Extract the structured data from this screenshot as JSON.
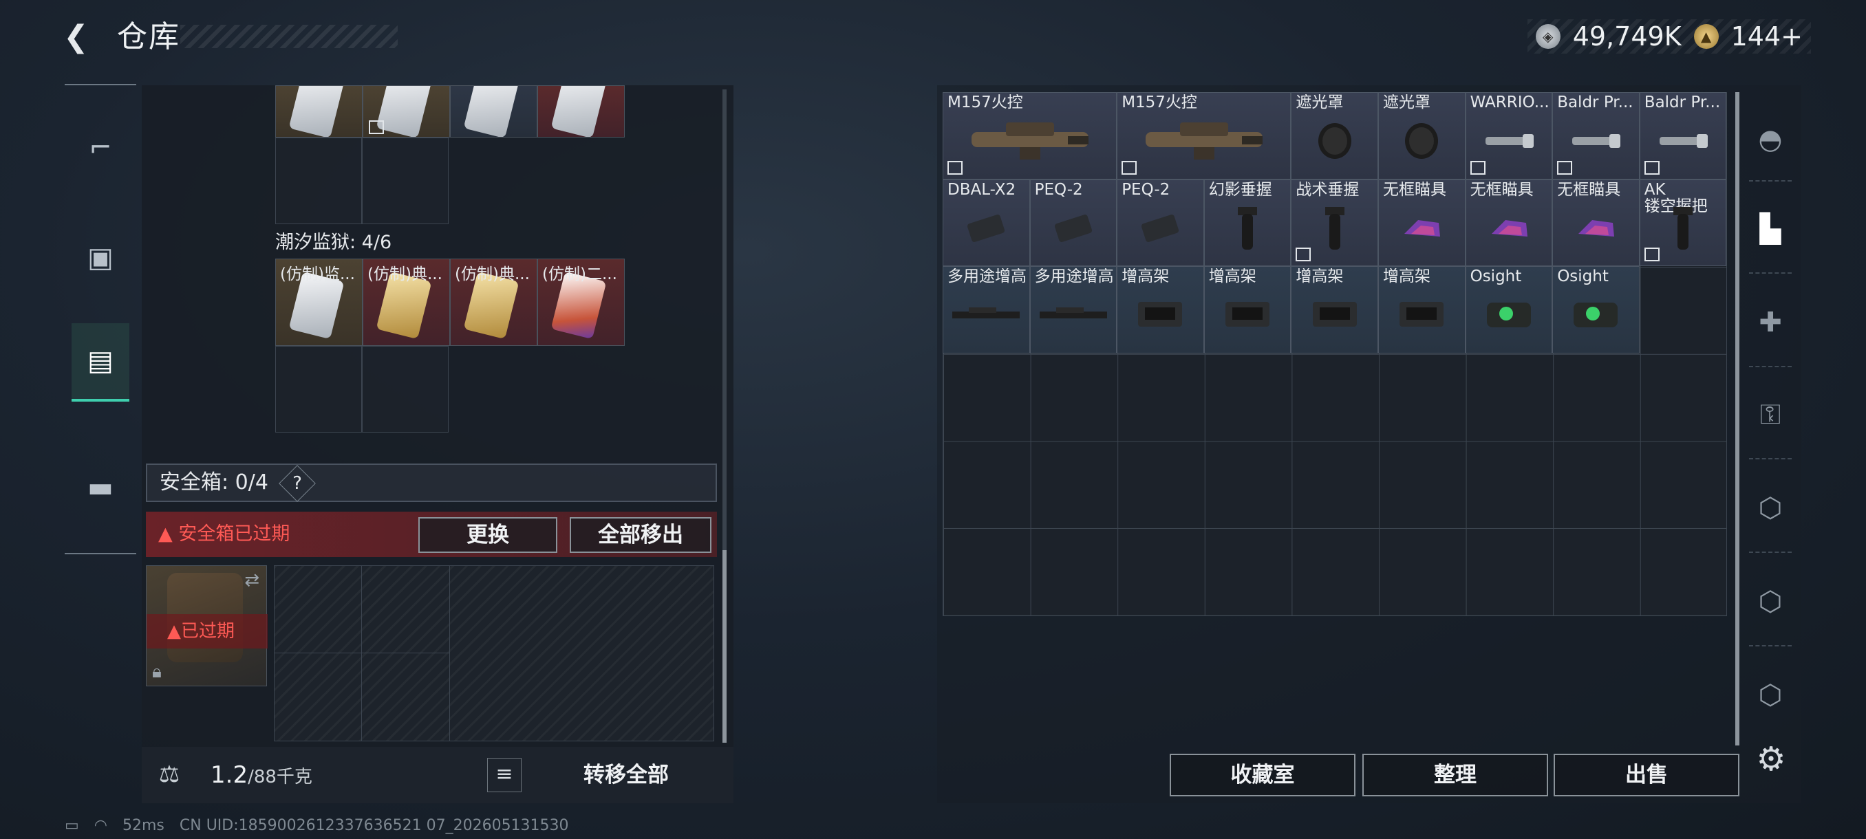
{
  "header": {
    "title": "仓库",
    "back_icon": "back-arrow-icon"
  },
  "currency": {
    "silver": "49,749K",
    "gold": "144+"
  },
  "left_nav": [
    "gun-icon",
    "backpack-icon",
    "chest-rig-icon",
    "briefcase-icon"
  ],
  "left_panel": {
    "tide_prison_label": "潮汐监狱: 4/6",
    "top_cards": [
      {
        "bg": "tan"
      },
      {
        "bg": "tan"
      },
      {
        "bg": "blu"
      },
      {
        "bg": "red"
      }
    ],
    "tide_cards": [
      {
        "label": "(仿制)监...",
        "bg": "tan",
        "img": "white"
      },
      {
        "label": "(仿制)典...",
        "bg": "red",
        "img": "gold"
      },
      {
        "label": "(仿制)典...",
        "bg": "red",
        "img": "gold"
      },
      {
        "label": "(仿制)二...",
        "bg": "red",
        "img": "multi"
      }
    ],
    "safe_label": "安全箱: 0/4",
    "help": "?",
    "expired_warning": "安全箱已过期",
    "replace_button": "更换",
    "move_all_out_button": "全部移出",
    "safebox_status": "已过期",
    "weight_value": "1.2",
    "weight_max": "/88千克",
    "transfer_all_button": "转移全部"
  },
  "status_bar": {
    "ping": "52ms",
    "uid": "CN UID:1859002612337636521 07_202605131530"
  },
  "right_grid": {
    "rows": [
      [
        {
          "label": "M157火控",
          "span": 2,
          "pic": "scope",
          "nomod": true,
          "bg": 1
        },
        {
          "label": "M157火控",
          "span": 2,
          "pic": "scope",
          "nomod": true,
          "bg": 1
        },
        {
          "label": "遮光罩",
          "span": 1,
          "pic": "hood",
          "nomod": false,
          "bg": 1
        },
        {
          "label": "遮光罩",
          "span": 1,
          "pic": "hood",
          "nomod": false,
          "bg": 1
        },
        {
          "label": "WARRIO...",
          "span": 1,
          "pic": "light",
          "nomod": true,
          "bg": 1
        },
        {
          "label": "Baldr Pr...",
          "span": 1,
          "pic": "light",
          "nomod": true,
          "bg": 1
        },
        {
          "label": "Baldr Pr...",
          "span": 1,
          "pic": "light",
          "nomod": true,
          "bg": 1
        }
      ],
      [
        {
          "label": "DBAL-X2",
          "span": 1,
          "pic": "laser",
          "nomod": false,
          "bg": 1
        },
        {
          "label": "PEQ-2",
          "span": 1,
          "pic": "laser",
          "nomod": false,
          "bg": 1
        },
        {
          "label": "PEQ-2",
          "span": 1,
          "pic": "laser",
          "nomod": false,
          "bg": 1
        },
        {
          "label": "幻影垂握",
          "span": 1,
          "pic": "grip",
          "nomod": false,
          "bg": 1
        },
        {
          "label": "战术垂握",
          "span": 1,
          "pic": "grip",
          "nomod": true,
          "bg": 1
        },
        {
          "label": "无框瞄具",
          "span": 1,
          "pic": "sight",
          "nomod": false,
          "bg": 1
        },
        {
          "label": "无框瞄具",
          "span": 1,
          "pic": "sight",
          "nomod": false,
          "bg": 1
        },
        {
          "label": "无框瞄具",
          "span": 1,
          "pic": "sight",
          "nomod": false,
          "bg": 1
        },
        {
          "label": "AK\n镂空握把",
          "span": 1,
          "pic": "grip",
          "nomod": true,
          "bg": 1
        }
      ],
      [
        {
          "label": "多用途增高",
          "span": 1,
          "pic": "rail",
          "nomod": false,
          "bg": 2
        },
        {
          "label": "多用途增高",
          "span": 1,
          "pic": "rail",
          "nomod": false,
          "bg": 2
        },
        {
          "label": "增高架",
          "span": 1,
          "pic": "mount",
          "nomod": false,
          "bg": 2
        },
        {
          "label": "增高架",
          "span": 1,
          "pic": "mount",
          "nomod": false,
          "bg": 2
        },
        {
          "label": "增高架",
          "span": 1,
          "pic": "mount",
          "nomod": false,
          "bg": 2
        },
        {
          "label": "增高架",
          "span": 1,
          "pic": "mount",
          "nomod": false,
          "bg": 2
        },
        {
          "label": "Osight",
          "span": 1,
          "pic": "osight",
          "nomod": false,
          "bg": 2
        },
        {
          "label": "Osight",
          "span": 1,
          "pic": "osight",
          "nomod": false,
          "bg": 2
        }
      ]
    ]
  },
  "right_buttons": {
    "collection": "收藏室",
    "sort": "整理",
    "sell": "出售"
  },
  "right_nav": [
    "helmet-icon",
    "weapon-bench-icon",
    "iv-medkit-icon",
    "iv-key-icon",
    "iv-armor-icon",
    "iv-armor-icon",
    "iv-armor-icon"
  ],
  "settings_icon": "gear-icon"
}
